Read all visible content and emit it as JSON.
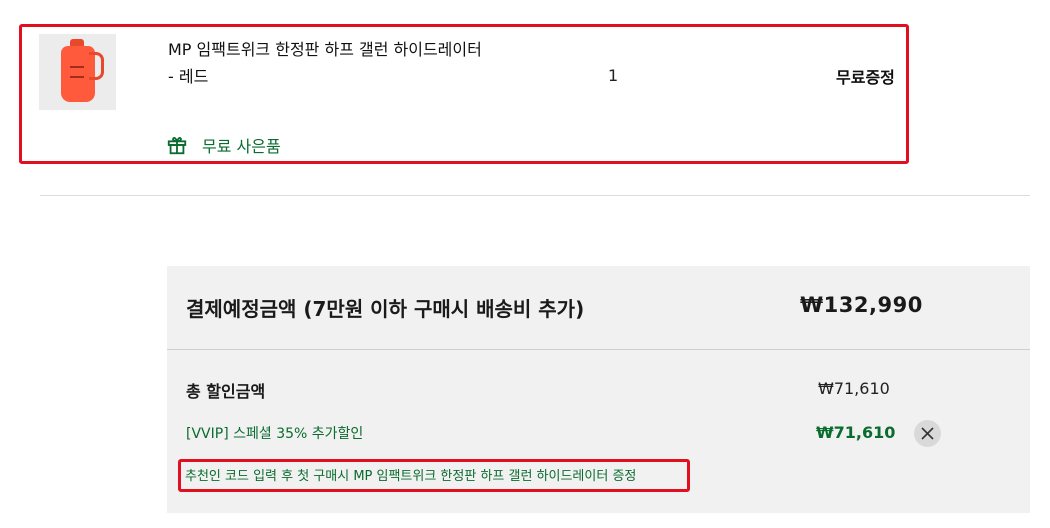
{
  "product": {
    "name_line1": "MP 임팩트위크 한정판 하프 갤런 하이드레이터",
    "name_line2": "- 레드",
    "quantity": "1",
    "price": "무료증정",
    "gift_label": "무료 사은품",
    "thumbnail_icon": "red-water-jug-image",
    "gift_icon": "gift-icon"
  },
  "summary": {
    "payment_label": "결제예정금액 (7만원 이하 구매시 배송비 추가)",
    "payment_amount": "₩132,990",
    "discount_label": "총 할인금액",
    "discount_amount": "₩71,610",
    "promo_label": "[VVIP] 스페셜 35% 추가할인",
    "promo_amount": "₩71,610",
    "remove_icon": "close-icon",
    "note": "추천인 코드 입력 후 첫 구매시 MP 임팩트위크 한정판 하프 갤런 하이드레이터 증정"
  },
  "colors": {
    "highlight_border": "#e0101e",
    "green_text": "#0a6b2e",
    "summary_bg": "#f1f1f1"
  }
}
